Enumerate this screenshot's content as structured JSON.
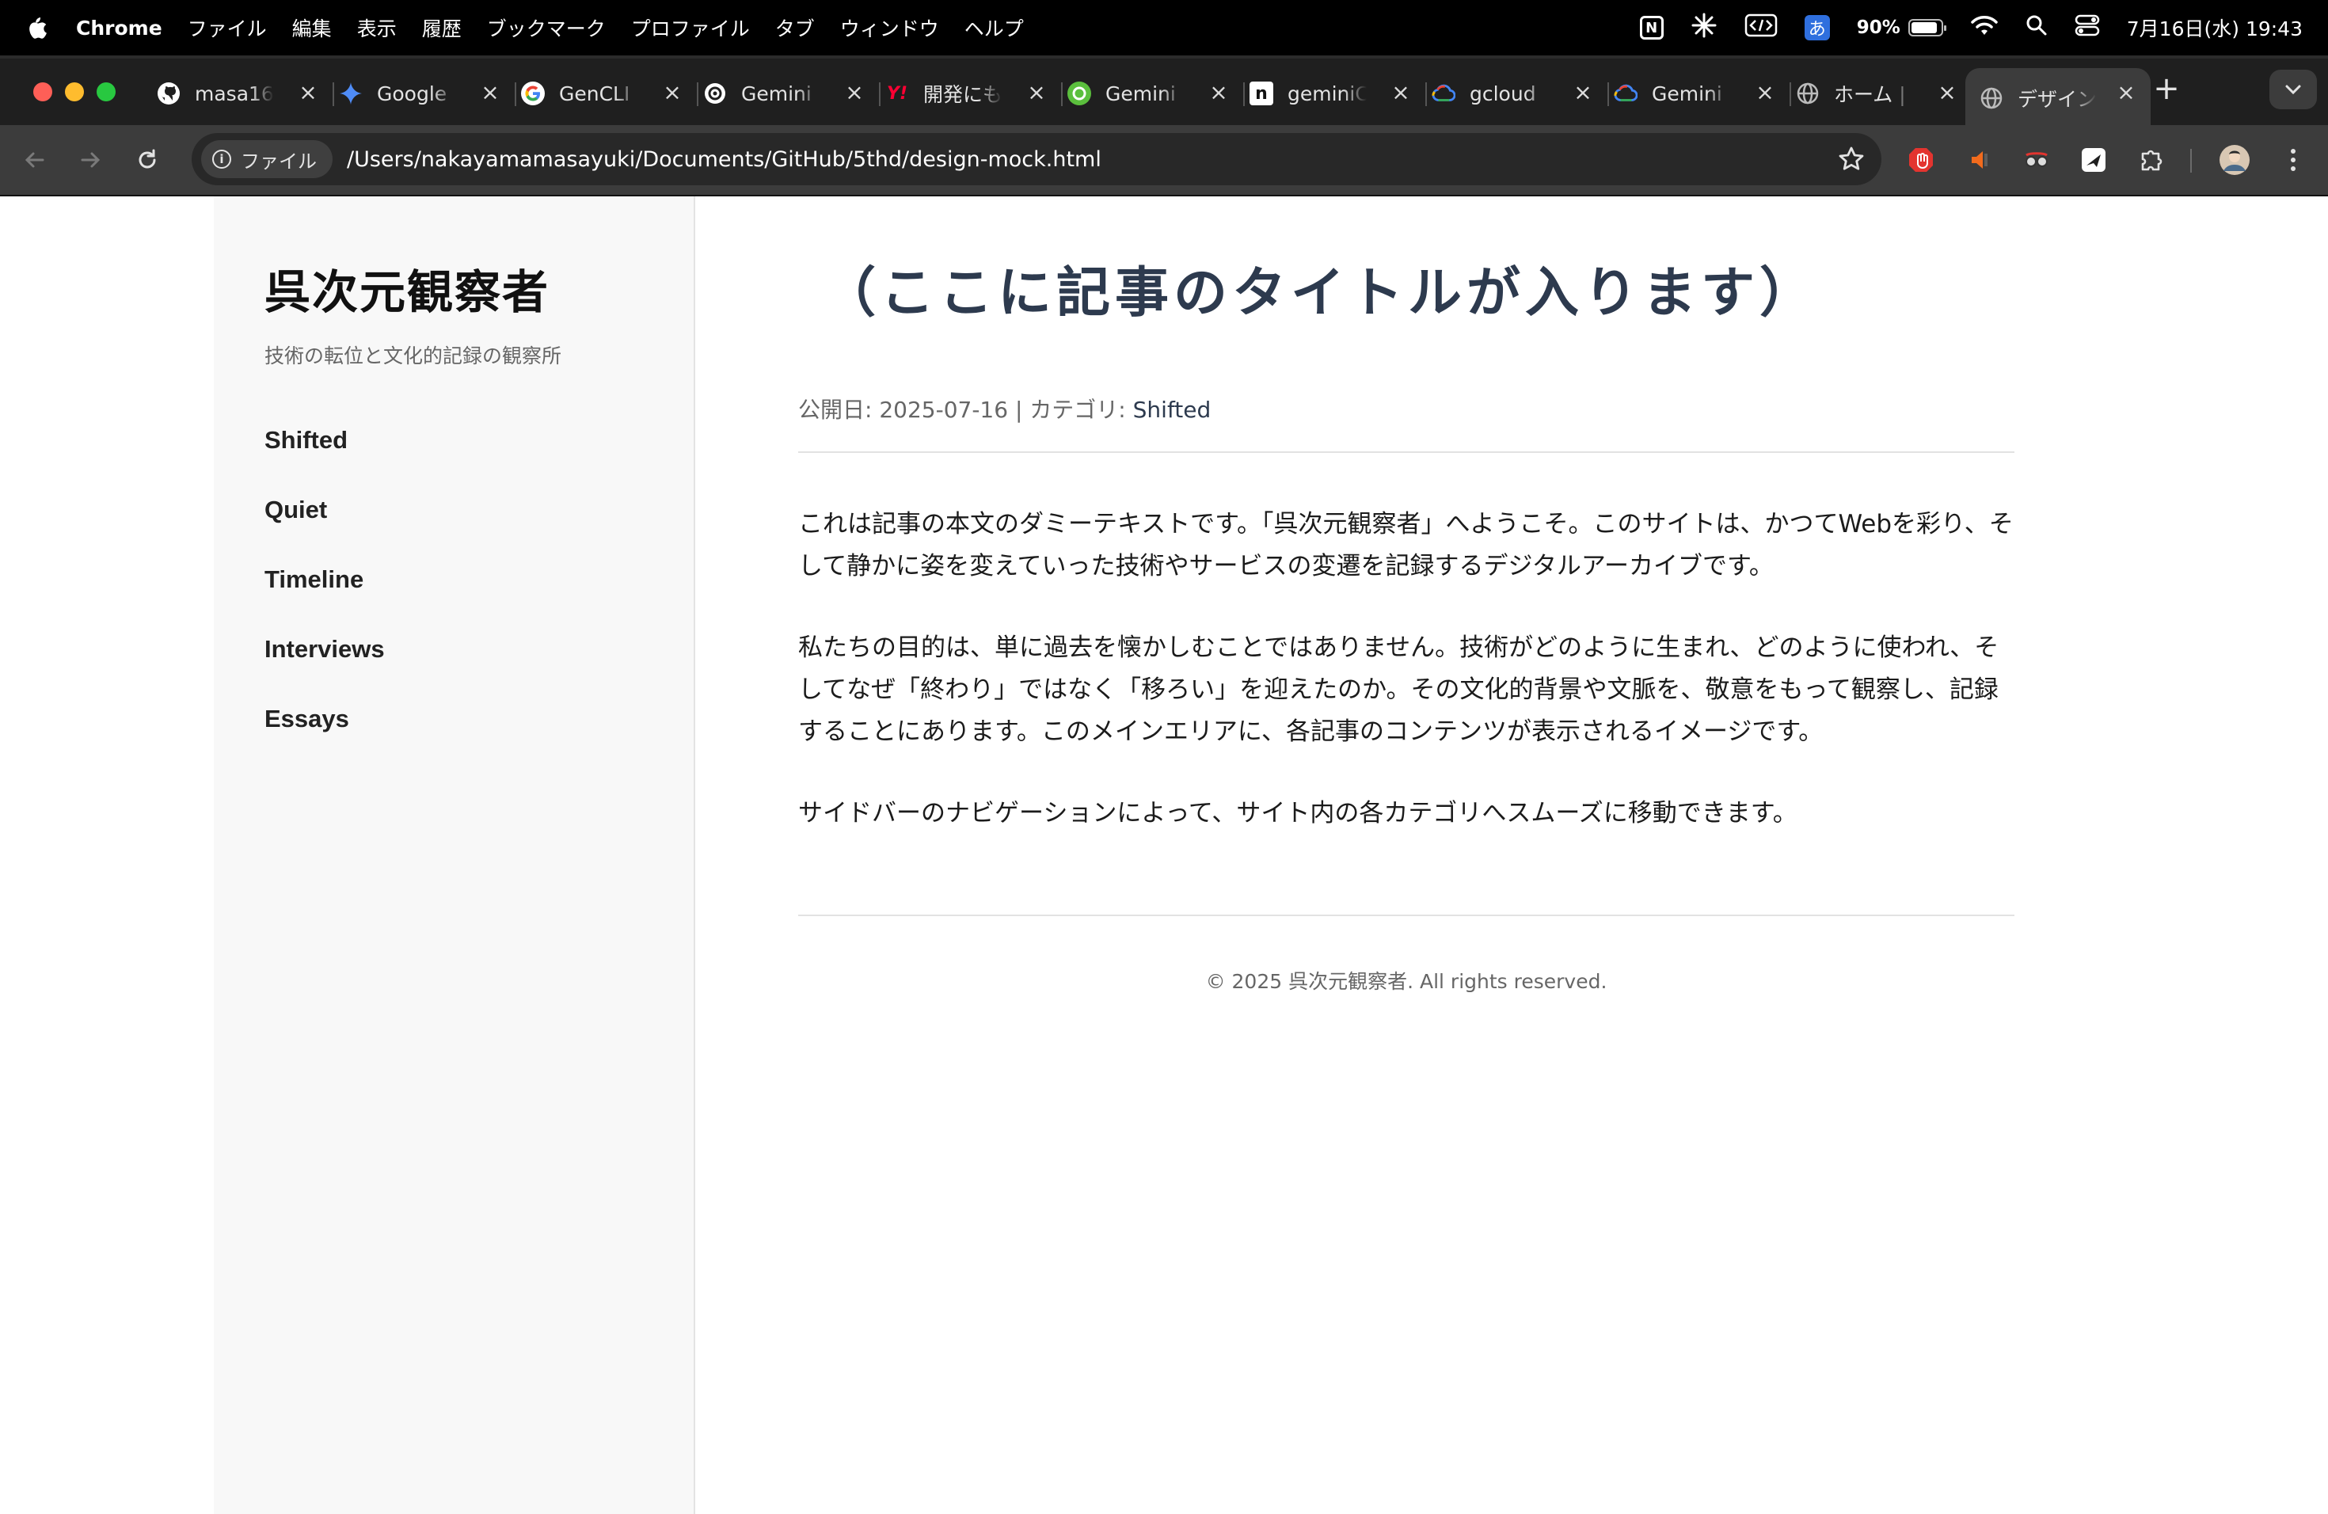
{
  "menubar": {
    "app_name": "Chrome",
    "items": [
      "ファイル",
      "編集",
      "表示",
      "履歴",
      "ブックマーク",
      "プロファイル",
      "タブ",
      "ウィンドウ",
      "ヘルプ"
    ],
    "battery_percent": "90%",
    "battery_level": 0.9,
    "ime_label": "あ",
    "notion_glyph": "N",
    "datetime": "7月16日(水) 19:43"
  },
  "tabs": [
    {
      "title": "masa16",
      "favicon": "github-icon",
      "color": "#ffffff"
    },
    {
      "title": "Google",
      "favicon": "gemini-star-icon",
      "color": "#4f8cf7"
    },
    {
      "title": "GenCLI",
      "favicon": "google-icon",
      "color": "#ffffff"
    },
    {
      "title": "Gemini",
      "favicon": "openai-icon",
      "color": "#ffffff"
    },
    {
      "title": "開発にも",
      "favicon": "yahoo-icon",
      "color": "#ff0033"
    },
    {
      "title": "Gemini",
      "favicon": "chat-icon",
      "color": "#5bbf3d"
    },
    {
      "title": "geminiC",
      "favicon": "note-icon",
      "color": "#ffffff"
    },
    {
      "title": "gcloud",
      "favicon": "gcloud-icon",
      "color": "#4285f4"
    },
    {
      "title": "Gemini",
      "favicon": "gcloud-icon",
      "color": "#4285f4"
    },
    {
      "title": "ホーム |",
      "favicon": "globe-icon",
      "color": "#bbbbbb"
    },
    {
      "title": "デザイン",
      "favicon": "globe-icon",
      "color": "#bbbbbb",
      "active": true
    }
  ],
  "toolbar": {
    "origin_label": "ファイル",
    "url": "/Users/nakayamamasayuki/Documents/GitHub/5thd/design-mock.html"
  },
  "sidebar": {
    "site_title": "呉次元観察者",
    "tagline": "技術の転位と文化的記録の観察所",
    "nav": [
      "Shifted",
      "Quiet",
      "Timeline",
      "Interviews",
      "Essays"
    ]
  },
  "article": {
    "title": "（ここに記事のタイトルが入ります）",
    "meta_prefix": "公開日: 2025-07-16 | カテゴリ: ",
    "category": "Shifted",
    "paragraphs": [
      "これは記事の本文のダミーテキストです。「呉次元観察者」へようこそ。このサイトは、かつてWebを彩り、そして静かに姿を変えていった技術やサービスの変遷を記録するデジタルアーカイブです。",
      "私たちの目的は、単に過去を懐かしむことではありません。技術がどのように生まれ、どのように使われ、そしてなぜ「終わり」ではなく「移ろい」を迎えたのか。その文化的背景や文脈を、敬意をもって観察し、記録することにあります。このメインエリアに、各記事のコンテンツが表示されるイメージです。",
      "サイドバーのナビゲーションによって、サイト内の各カテゴリへスムーズに移動できます。"
    ],
    "footer": "© 2025 呉次元観察者. All rights reserved."
  }
}
